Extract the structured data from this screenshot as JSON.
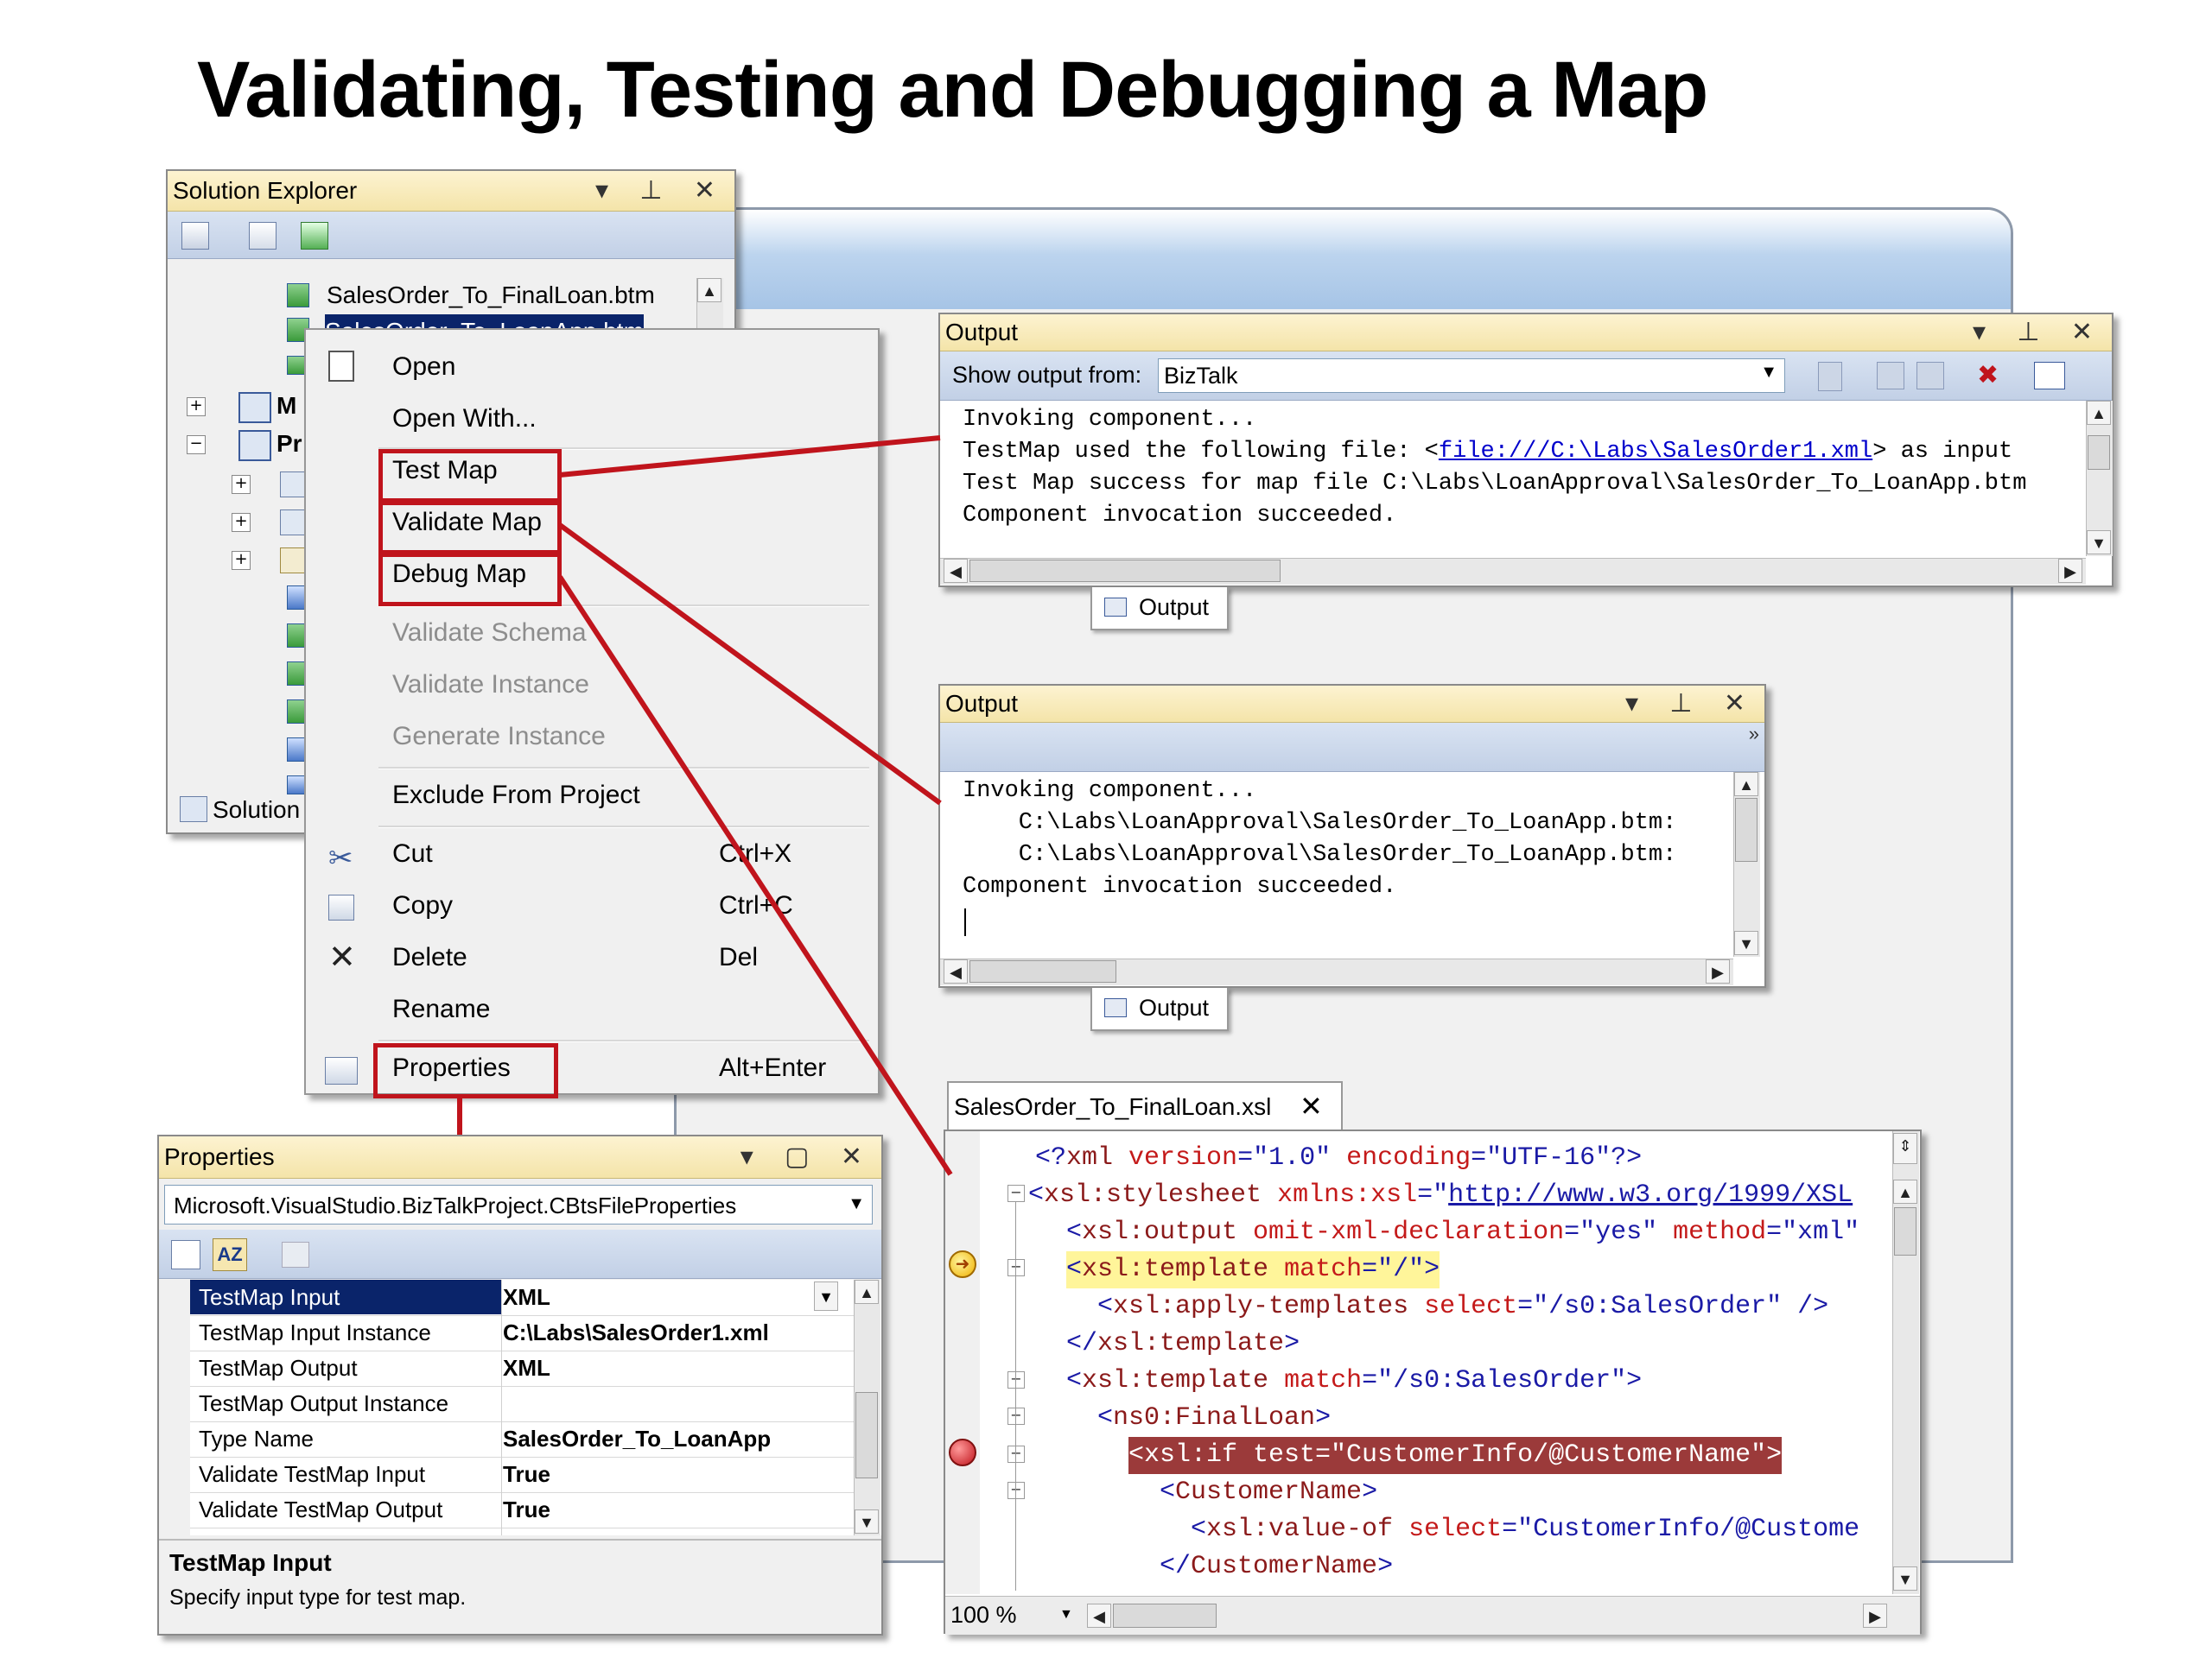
{
  "slide": {
    "title": "Validating, Testing and Debugging a Map"
  },
  "solution_explorer": {
    "title": "Solution Explorer",
    "items": [
      {
        "label": "SalesOrder_To_FinalLoan.btm"
      },
      {
        "label": "SalesOrder_To_LoanApp.btm"
      },
      {
        "label": "M"
      },
      {
        "label": "Pr"
      }
    ],
    "footer_tab": "Solution"
  },
  "context_menu": {
    "items": [
      {
        "label": "Open",
        "shortcut": "",
        "enabled": true
      },
      {
        "label": "Open With...",
        "shortcut": "",
        "enabled": true
      },
      {
        "label": "Test Map",
        "shortcut": "",
        "enabled": true
      },
      {
        "label": "Validate Map",
        "shortcut": "",
        "enabled": true
      },
      {
        "label": "Debug Map",
        "shortcut": "",
        "enabled": true
      },
      {
        "label": "Validate Schema",
        "shortcut": "",
        "enabled": false
      },
      {
        "label": "Validate Instance",
        "shortcut": "",
        "enabled": false
      },
      {
        "label": "Generate Instance",
        "shortcut": "",
        "enabled": false
      },
      {
        "label": "Exclude From Project",
        "shortcut": "",
        "enabled": true
      },
      {
        "label": "Cut",
        "shortcut": "Ctrl+X",
        "enabled": true
      },
      {
        "label": "Copy",
        "shortcut": "Ctrl+C",
        "enabled": true
      },
      {
        "label": "Delete",
        "shortcut": "Del",
        "enabled": true
      },
      {
        "label": "Rename",
        "shortcut": "",
        "enabled": true
      },
      {
        "label": "Properties",
        "shortcut": "Alt+Enter",
        "enabled": true
      }
    ]
  },
  "output_top": {
    "title": "Output",
    "show_output_label": "Show output from:",
    "source": "BizTalk",
    "lines": [
      "Invoking component...",
      "TestMap used the following file: <",
      "Test Map success for map file C:\\Labs\\LoanApproval\\SalesOrder_To_LoanApp.btm",
      "Component invocation succeeded."
    ],
    "link": "file:///C:\\Labs\\SalesOrder1.xml",
    "link_suffix": "> as input",
    "tab": "Output"
  },
  "output_middle": {
    "title": "Output",
    "lines": [
      "Invoking component...",
      "    C:\\Labs\\LoanApproval\\SalesOrder_To_LoanApp.btm:",
      "    C:\\Labs\\LoanApproval\\SalesOrder_To_LoanApp.btm:",
      "Component invocation succeeded."
    ],
    "tab": "Output"
  },
  "properties": {
    "title": "Properties",
    "object": "Microsoft.VisualStudio.BizTalkProject.CBtsFileProperties",
    "rows": [
      {
        "name": "TestMap Input",
        "value": "XML"
      },
      {
        "name": "TestMap Input Instance",
        "value": "C:\\Labs\\SalesOrder1.xml"
      },
      {
        "name": "TestMap Output",
        "value": "XML"
      },
      {
        "name": "TestMap Output Instance",
        "value": ""
      },
      {
        "name": "Type Name",
        "value": "SalesOrder_To_LoanApp"
      },
      {
        "name": "Validate TestMap Input",
        "value": "True"
      },
      {
        "name": "Validate TestMap Output",
        "value": "True"
      }
    ],
    "desc_title": "TestMap Input",
    "desc_text": "Specify input type for test map."
  },
  "xsl_editor": {
    "tab": "SalesOrder_To_FinalLoan.xsl",
    "zoom": "100 %",
    "l1": {
      "a": "<?",
      "b": "xml",
      "c": " version",
      "d": "=\"1.0\"",
      "e": " encoding",
      "f": "=\"UTF-16\"?>"
    },
    "l2": {
      "a": "<",
      "b": "xsl:stylesheet",
      "c": " xmlns:xsl",
      "d": "=\"",
      "link": "http://www.w3.org/1999/XSL"
    },
    "l3": {
      "a": "<",
      "b": "xsl:output",
      "c": " omit-xml-declaration",
      "d": "=\"yes\"",
      "e": " method",
      "f": "=\"xml\""
    },
    "l4": {
      "a": "<",
      "b": "xsl:template",
      "c": " match",
      "d": "=\"/\">"
    },
    "l5": {
      "a": "<",
      "b": "xsl:apply-templates",
      "c": " select",
      "d": "=\"/s0:SalesOrder\" />"
    },
    "l6": {
      "a": "</",
      "b": "xsl:template",
      "c": ">"
    },
    "l7": {
      "a": "<",
      "b": "xsl:template",
      "c": " match",
      "d": "=\"/s0:SalesOrder\">"
    },
    "l8": {
      "a": "<",
      "b": "ns0:FinalLoan",
      "c": ">"
    },
    "l9": {
      "text": "<xsl:if test=\"CustomerInfo/@CustomerName\">"
    },
    "l10": {
      "a": "<",
      "b": "CustomerName",
      "c": ">"
    },
    "l11": {
      "a": "<",
      "b": "xsl:value-of",
      "c": " select",
      "d": "=\"CustomerInfo/@Custome"
    },
    "l12": {
      "a": "</",
      "b": "CustomerName",
      "c": ">"
    }
  },
  "colors": {
    "callout_red": "#c0141c",
    "titlebar": "#f4e4a9",
    "selection": "#0a246a"
  }
}
